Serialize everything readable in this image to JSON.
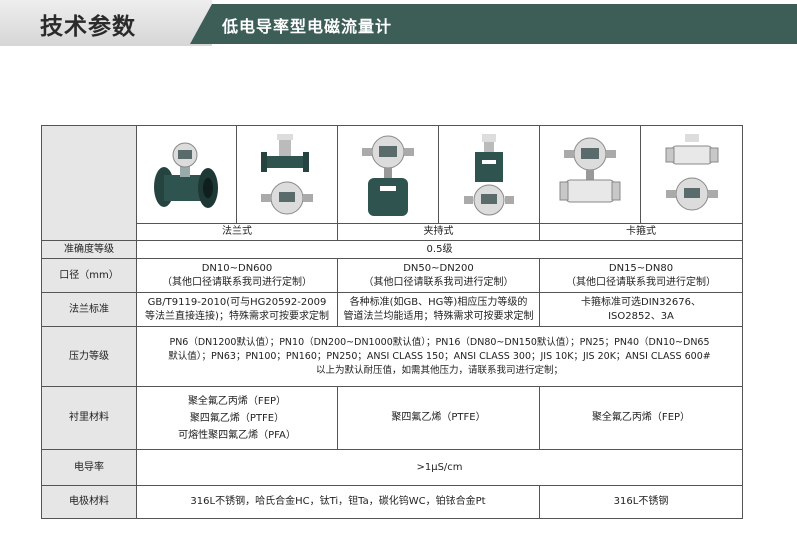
{
  "header": {
    "left_title": "技术参数",
    "right_title": "低电导率型电磁流量计"
  },
  "table": {
    "types": [
      "法兰式",
      "夹持式",
      "卡箍式"
    ],
    "images": [
      "flange-meter-integral",
      "flange-meter-remote",
      "wafer-meter-integral",
      "wafer-meter-remote",
      "clamp-meter-integral",
      "clamp-meter-remote"
    ],
    "rows": {
      "accuracy": {
        "label": "准确度等级",
        "value": "0.5级"
      },
      "diameter": {
        "label": "口径（mm）",
        "flange": [
          "DN10~DN600",
          "（其他口径请联系我司进行定制）"
        ],
        "wafer": [
          "DN50~DN200",
          "（其他口径请联系我司进行定制）"
        ],
        "clamp": [
          "DN15~DN80",
          "（其他口径请联系我司进行定制）"
        ]
      },
      "flange_std": {
        "label": "法兰标准",
        "flange": [
          "GB/T9119-2010(可与HG20592-2009",
          "等法兰直接连接)；特殊需求可按要求定制"
        ],
        "wafer": [
          "各种标准(如GB、HG等)相应压力等级的",
          "管道法兰均能适用；特殊需求可按要求定制"
        ],
        "clamp": [
          "卡箍标准可选DIN32676、",
          "ISO2852、3A"
        ]
      },
      "pressure": {
        "label": "压力等级",
        "lines": [
          "PN6（DN1200默认值）；PN10（DN200~DN1000默认值）；PN16（DN80~DN150默认值）；PN25；PN40（DN10~DN65",
          "默认值）；PN63；PN100；PN160；PN250；ANSI CLASS 150；ANSI CLASS 300；JIS 10K；JIS 20K；ANSI CLASS 600#",
          "以上为默认耐压值，如需其他压力，请联系我司进行定制；"
        ]
      },
      "lining": {
        "label": "衬里材料",
        "flange": [
          "聚全氟乙丙烯（FEP）",
          "聚四氟乙烯（PTFE）",
          "可熔性聚四氟乙烯（PFA）"
        ],
        "wafer": "聚四氟乙烯（PTFE）",
        "clamp": "聚全氟乙丙烯（FEP）"
      },
      "conductivity": {
        "label": "电导率",
        "value": ">1μS/cm"
      },
      "electrode": {
        "label": "电极材料",
        "flange_wafer": "316L不锈钢，哈氏合金HC，钛Ti，钽Ta，碳化钨WC，铂铱合金Pt",
        "clamp": "316L不锈钢"
      }
    }
  },
  "colors": {
    "banner": "#3d5d57",
    "label_bg": "#e6e6e6",
    "border": "#555555"
  }
}
